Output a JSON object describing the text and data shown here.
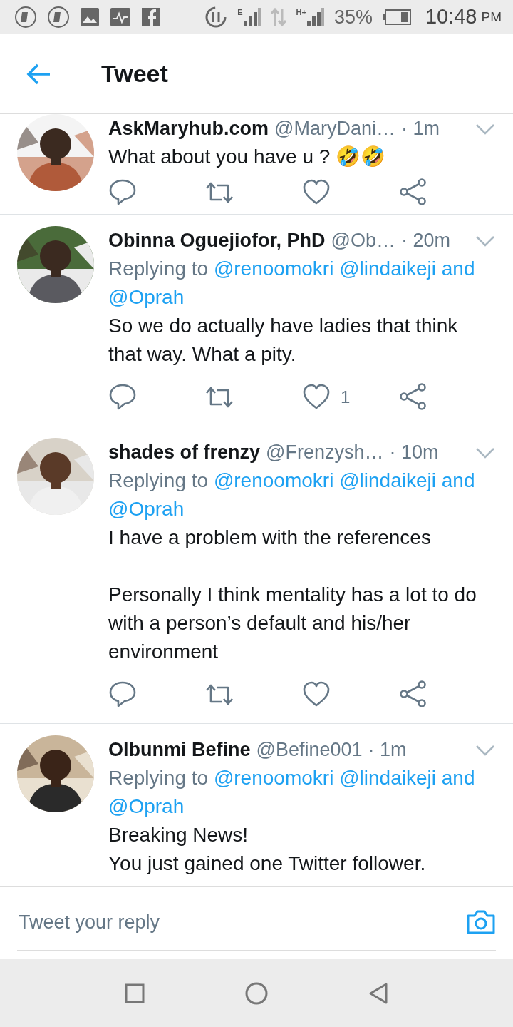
{
  "status_bar": {
    "signals": [
      {
        "label": "E"
      },
      {
        "label": "H+"
      }
    ],
    "battery": "35%",
    "time": "10:48",
    "ampm": "PM"
  },
  "header": {
    "title": "Tweet"
  },
  "tweets": [
    {
      "name": "AskMaryhub.com",
      "handle": "@MaryDani…",
      "time": "· 1m",
      "paragraphs": [
        "What about you have u ? 🤣🤣"
      ]
    },
    {
      "name": "Obinna Oguejiofor, PhD",
      "handle": "@Ob…",
      "time": "· 20m",
      "replying": {
        "prefix": "Replying to",
        "mentions": [
          "@renoomokri",
          "@lindaikeji"
        ],
        "conjunction": "and",
        "last": "@Oprah"
      },
      "paragraphs": [
        "So we do actually have ladies that think that way. What a pity."
      ],
      "like_count": "1"
    },
    {
      "name": "shades of frenzy",
      "handle": "@Frenzysh…",
      "time": "· 10m",
      "replying": {
        "prefix": "Replying to",
        "mentions": [
          "@renoomokri",
          "@lindaikeji"
        ],
        "conjunction": "and",
        "last": "@Oprah"
      },
      "paragraphs": [
        "I have a problem with the references",
        "Personally I think mentality has a lot to do with a person’s default and his/her environment"
      ]
    },
    {
      "name": "Olbunmi Befine",
      "handle": "@Befine001",
      "time": "· 1m",
      "replying": {
        "prefix": "Replying to",
        "mentions": [
          "@renoomokri",
          "@lindaikeji"
        ],
        "conjunction": "and",
        "last": "@Oprah"
      },
      "paragraphs": [
        "Breaking News!\nYou just gained one Twitter follower."
      ],
      "cut": true
    }
  ],
  "reply_bar": {
    "placeholder": "Tweet your reply"
  }
}
